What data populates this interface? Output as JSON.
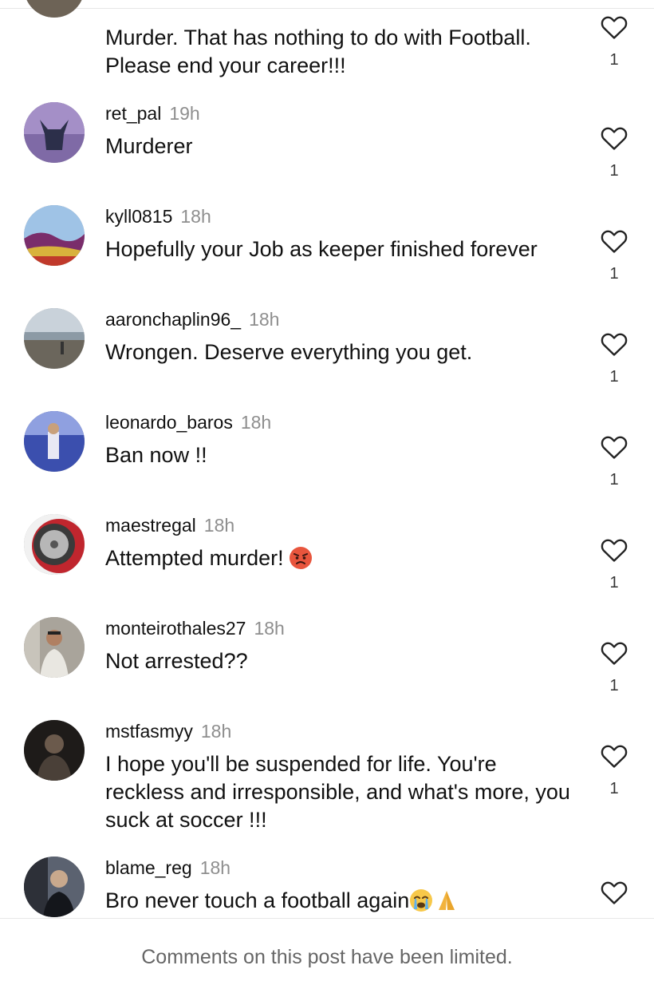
{
  "comments": [
    {
      "username": "",
      "time": "",
      "text": "Murder. That has nothing to do with Football. Please end your career!!!",
      "likes": "1",
      "avatar": "avatar-photo"
    },
    {
      "username": "ret_pal",
      "time": "19h",
      "text": "Murderer",
      "likes": "1",
      "avatar": "avatar-bull"
    },
    {
      "username": "kyll0815",
      "time": "18h",
      "text": "Hopefully your Job as keeper finished forever",
      "likes": "1",
      "avatar": "avatar-landscape"
    },
    {
      "username": "aaronchaplin96_",
      "time": "18h",
      "text": "Wrongen. Deserve everything you get.",
      "likes": "1",
      "avatar": "avatar-beach"
    },
    {
      "username": "leonardo_baros",
      "time": "18h",
      "text": "Ban now !!",
      "likes": "1",
      "avatar": "avatar-stadium"
    },
    {
      "username": "maestregal",
      "time": "18h",
      "text": "Attempted murder!",
      "likes": "1",
      "avatar": "avatar-wheel",
      "emoji": "angry-face-emoji"
    },
    {
      "username": "monteirothales27",
      "time": "18h",
      "text": "Not arrested??",
      "likes": "1",
      "avatar": "avatar-selfie"
    },
    {
      "username": "mstfasmyy",
      "time": "18h",
      "text": "I hope you'll be suspended for life. You're reckless and irresponsible, and what's more, you suck at soccer !!!",
      "likes": "1",
      "avatar": "avatar-dark"
    },
    {
      "username": "blame_reg",
      "time": "18h",
      "text": "Bro never touch a football again",
      "likes": "",
      "avatar": "avatar-person",
      "emoji": "crying-face-emoji",
      "emoji2": "folded-hands-emoji"
    }
  ],
  "footer": {
    "text": "Comments on this post have been limited."
  },
  "colors": {
    "text": "#111111",
    "secondary": "#8e8e8e",
    "footer_text": "#666666",
    "divider": "#e8e8e8"
  },
  "icons": {
    "like": "heart-outline-icon"
  }
}
